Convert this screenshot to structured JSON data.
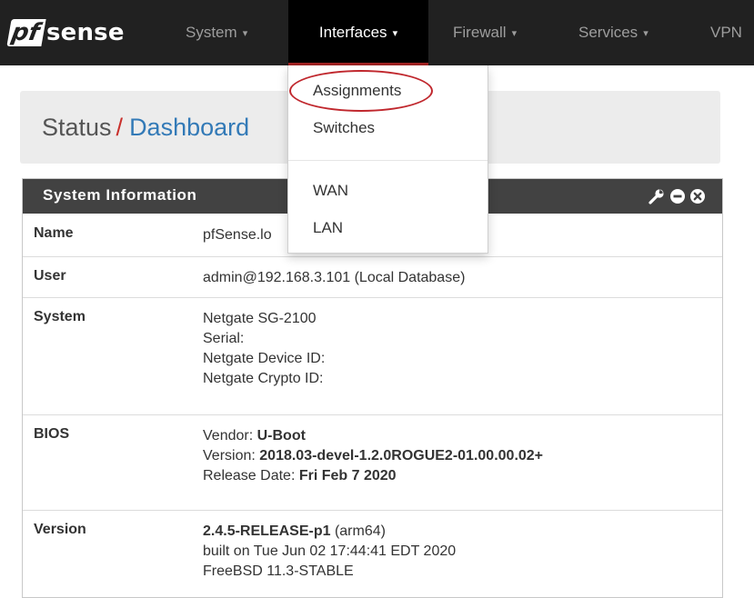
{
  "navbar": {
    "logo_pf": "pf",
    "logo_sense": "sense",
    "items": [
      {
        "label": "System",
        "caret": "▾"
      },
      {
        "label": "Interfaces",
        "caret": "▾"
      },
      {
        "label": "Firewall",
        "caret": "▾"
      },
      {
        "label": "Services",
        "caret": "▾"
      },
      {
        "label": "VPN"
      }
    ],
    "active_item": "Interfaces",
    "active_accent": "#a12323"
  },
  "dropdown": {
    "items": [
      "Assignments",
      "Switches",
      "WAN",
      "LAN"
    ],
    "highlighted_item": "Assignments",
    "highlight_color": "#c0272d"
  },
  "breadcrumb": {
    "section": "Status",
    "separator": "/",
    "page": "Dashboard"
  },
  "panel": {
    "title": "System Information",
    "icons": [
      "wrench-icon",
      "minus-circle-icon",
      "close-circle-icon"
    ],
    "rows": [
      {
        "label": "Name",
        "lines": [
          "pfSense.lo"
        ]
      },
      {
        "label": "User",
        "lines": [
          "admin@192.168.3.101 (Local Database)"
        ]
      },
      {
        "label": "System",
        "lines": [
          "Netgate SG-2100",
          "Serial:",
          "Netgate Device ID:",
          "Netgate Crypto ID:"
        ]
      },
      {
        "label": "BIOS",
        "vendor_key": "Vendor:",
        "vendor_val": "U-Boot",
        "version_key": "Version:",
        "version_val": "2018.03-devel-1.2.0ROGUE2-01.00.00.02+",
        "release_key": "Release Date:",
        "release_val": "Fri Feb 7 2020"
      },
      {
        "label": "Version",
        "release": "2.4.5-RELEASE-p1",
        "arch": "(arm64)",
        "built": "built on Tue Jun 02 17:44:41 EDT 2020",
        "os": "FreeBSD 11.3-STABLE"
      }
    ]
  }
}
